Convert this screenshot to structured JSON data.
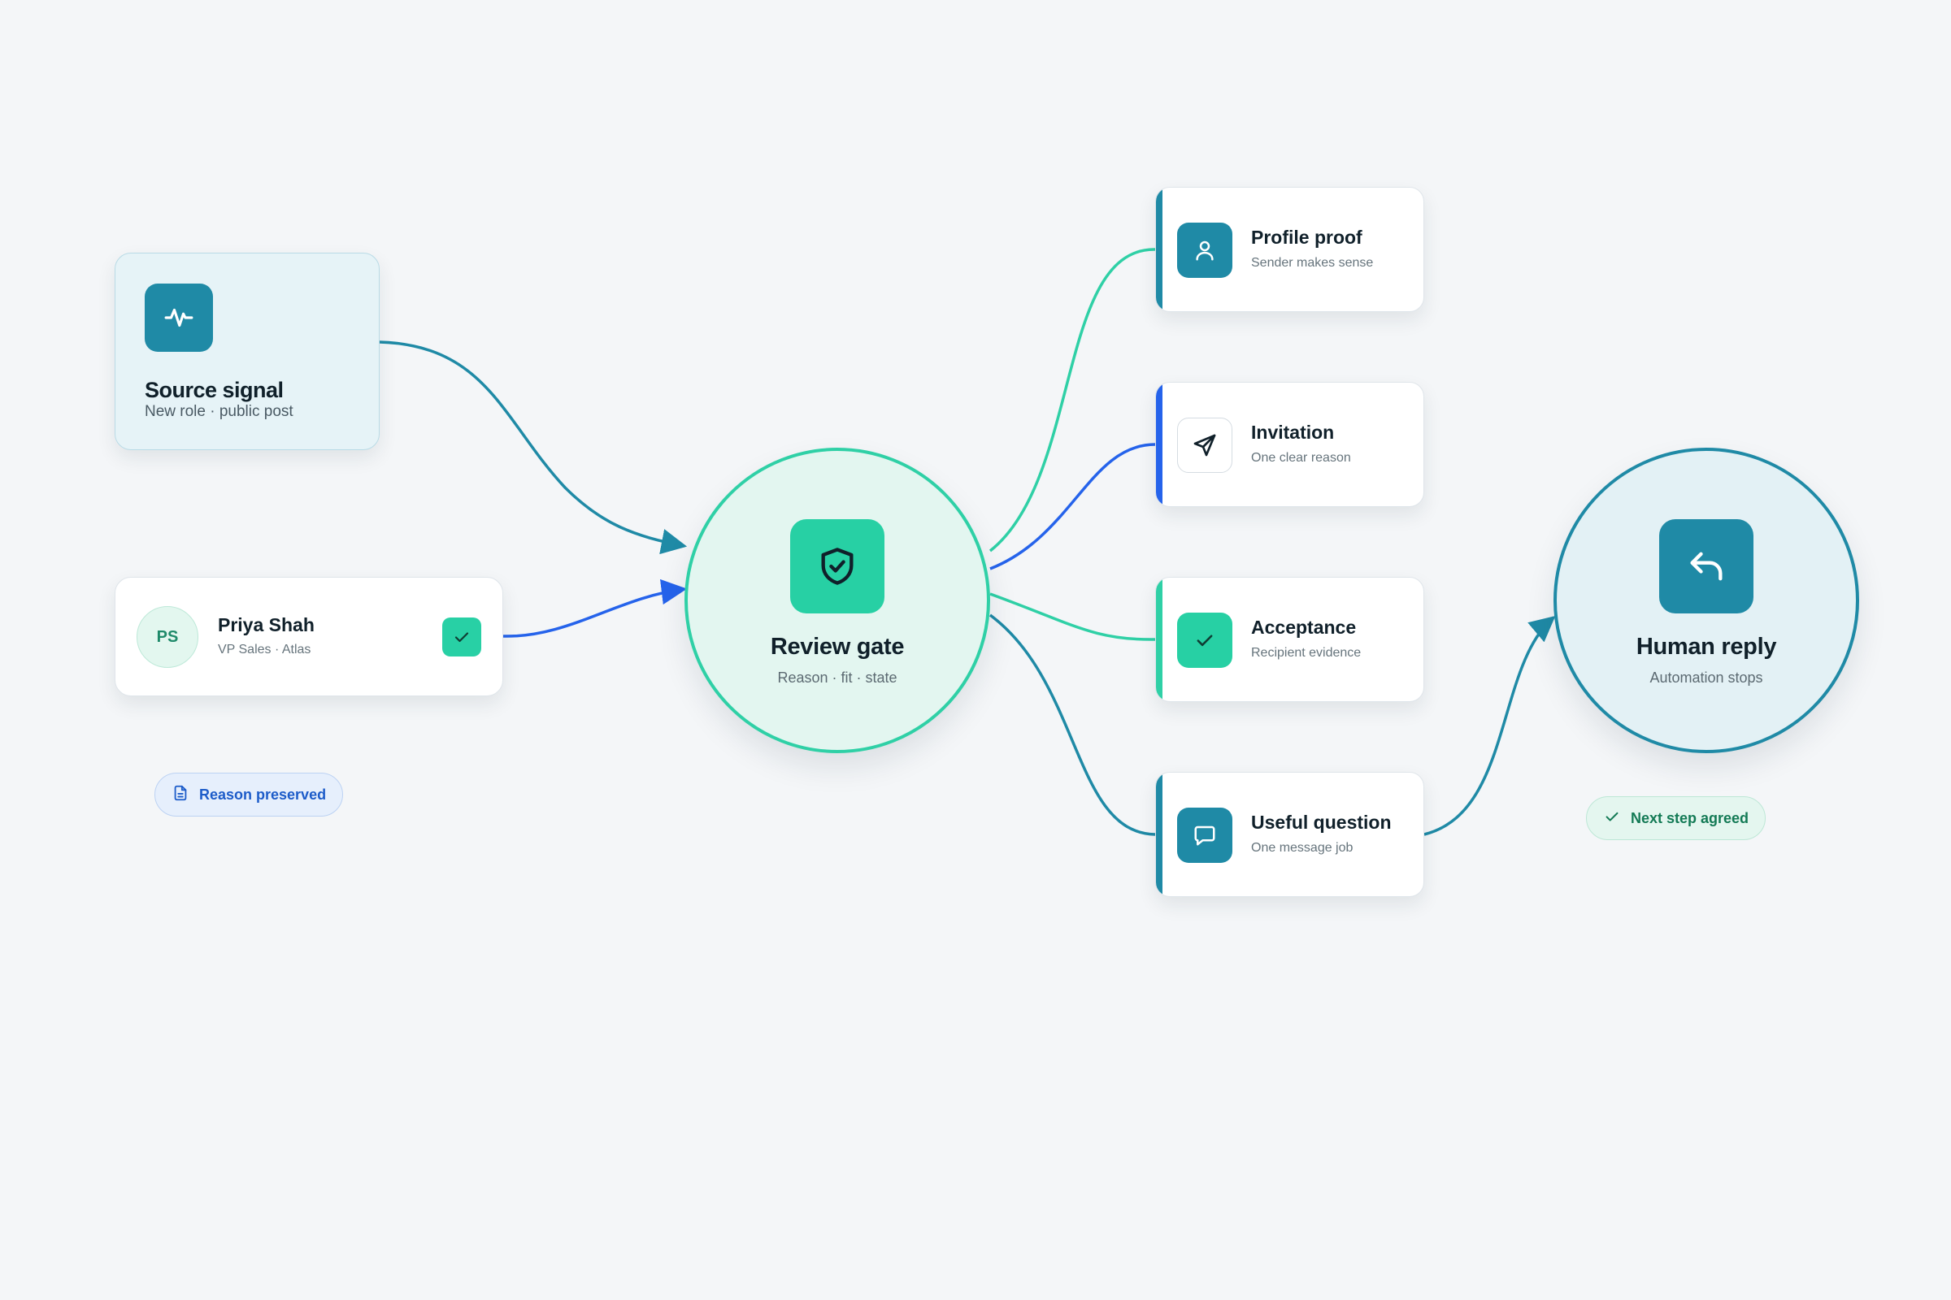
{
  "colors": {
    "background": "#f4f6f8",
    "teal": "#1f8aa6",
    "mint": "#2fd0a6",
    "blue": "#2563eb"
  },
  "source": {
    "title": "Source signal",
    "subtitle": "New role · public post",
    "icon": "activity-icon"
  },
  "person": {
    "initials": "PS",
    "name": "Priya Shah",
    "role": "VP Sales · Atlas",
    "icon": "check-icon"
  },
  "reason_pill": {
    "label": "Reason preserved",
    "icon": "document-icon"
  },
  "gate": {
    "title": "Review gate",
    "subtitle": "Reason · fit · state",
    "icon": "shield-check-icon"
  },
  "steps": [
    {
      "title": "Profile proof",
      "subtitle": "Sender makes sense",
      "icon": "user-icon",
      "accent": "#1f8aa6"
    },
    {
      "title": "Invitation",
      "subtitle": "One clear reason",
      "icon": "send-icon",
      "accent": "#2563eb"
    },
    {
      "title": "Acceptance",
      "subtitle": "Recipient evidence",
      "icon": "check-icon",
      "accent": "#2fd0a6"
    },
    {
      "title": "Useful question",
      "subtitle": "One message job",
      "icon": "message-icon",
      "accent": "#1f8aa6"
    }
  ],
  "reply": {
    "title": "Human reply",
    "subtitle": "Automation stops",
    "icon": "reply-icon"
  },
  "next_pill": {
    "label": "Next step agreed",
    "icon": "check-icon"
  }
}
